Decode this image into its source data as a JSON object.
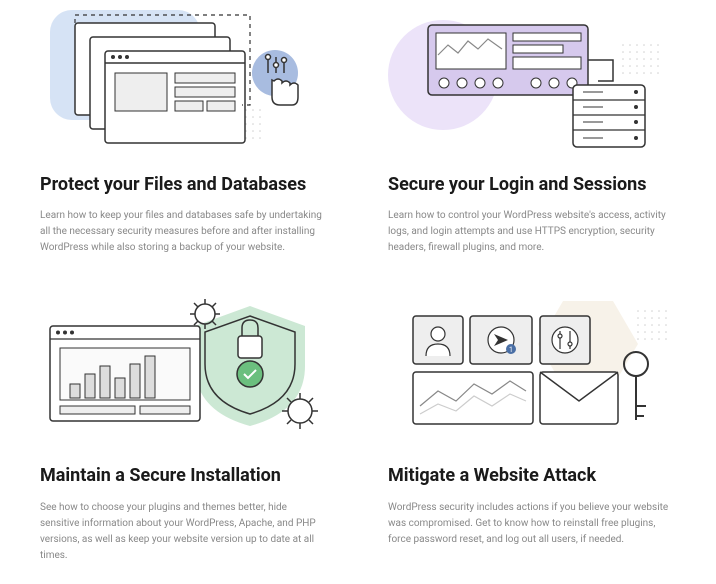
{
  "cards": [
    {
      "title": "Protect your Files and Databases",
      "desc": "Learn how to keep your files and databases safe by undertaking all the necessary security measures before and after installing WordPress while also storing a backup of your website."
    },
    {
      "title": "Secure your Login and Sessions",
      "desc": "Learn how to control your WordPress website's access, activity logs, and login attempts and use HTTPS encryption, security headers, firewall plugins, and more."
    },
    {
      "title": "Maintain a Secure Installation",
      "desc": "See how to choose your plugins and themes better, hide sensitive information about your WordPress, Apache, and PHP versions, as well as keep your website version up to date at all times."
    },
    {
      "title": "Mitigate a Website Attack",
      "desc": "WordPress security includes actions if you believe your website was compromised. Get to know how to reinstall free plugins, force password reset, and log out all users, if needed."
    }
  ]
}
